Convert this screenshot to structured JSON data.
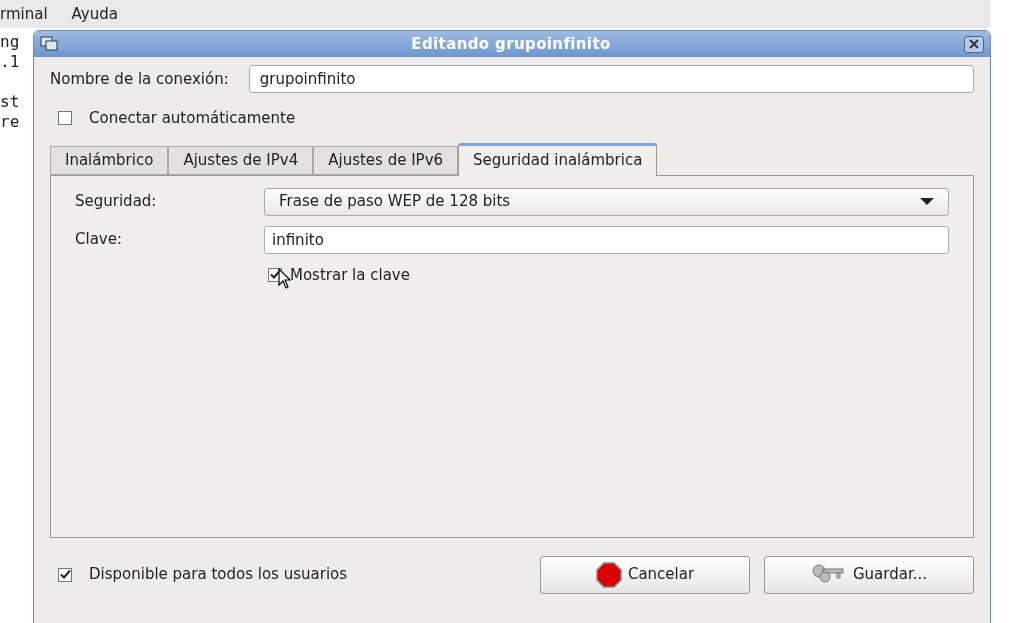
{
  "terminal": {
    "menu": [
      "rminal",
      "Ayuda"
    ],
    "lines": [
      "ng",
      ".1",
      "st",
      "re"
    ]
  },
  "dialog": {
    "title": "Editando grupoinfinito",
    "name_label": "Nombre de la conexión:",
    "name_value": "grupoinfinito",
    "autoconnect": {
      "label": "Conectar automáticamente",
      "checked": false
    },
    "tabs": [
      {
        "label": "Inalámbrico",
        "selected": false
      },
      {
        "label": "Ajustes de IPv4",
        "selected": false
      },
      {
        "label": "Ajustes de IPv6",
        "selected": false
      },
      {
        "label": "Seguridad inalámbrica",
        "selected": true
      }
    ],
    "security_label": "Seguridad:",
    "security_value": "Frase de paso WEP de 128 bits",
    "key_label": "Clave:",
    "key_value": "infinito",
    "show_key": {
      "label": "Mostrar la clave",
      "checked": true
    },
    "all_users": {
      "label": "Disponible para todos los usuarios",
      "checked": true
    },
    "buttons": [
      {
        "kind": "cancel",
        "label": "Cancelar"
      },
      {
        "kind": "save",
        "label": "Guardar..."
      }
    ]
  }
}
